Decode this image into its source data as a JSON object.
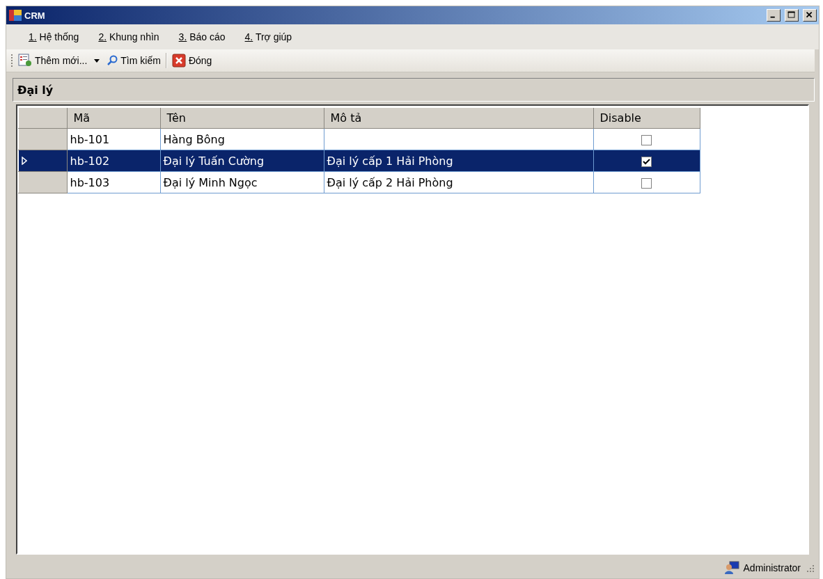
{
  "window": {
    "title": "CRM"
  },
  "menu": [
    {
      "label": "1. Hệ thống"
    },
    {
      "label": "2. Khung nhìn"
    },
    {
      "label": "3. Báo cáo"
    },
    {
      "label": "4. Trợ giúp"
    }
  ],
  "toolbar": [
    {
      "kind": "add",
      "label": "Thêm mới..."
    },
    {
      "kind": "dropdown"
    },
    {
      "kind": "search",
      "label": "Tìm kiếm"
    },
    {
      "kind": "separator"
    },
    {
      "kind": "close",
      "label": "Đóng"
    }
  ],
  "panel": {
    "title": "Đại lý"
  },
  "table": {
    "columns": [
      "Mã",
      "Tên",
      "Mô tả",
      "Disable"
    ],
    "rows": [
      {
        "code": "hb-101",
        "name": "Hàng Bông",
        "description": "",
        "disabled": false,
        "selected": false
      },
      {
        "code": "hb-102",
        "name": "Đại lý Tuấn Cường",
        "description": "Đại lý cấp 1 Hải Phòng",
        "disabled": true,
        "selected": true
      },
      {
        "code": "hb-103",
        "name": "Đại lý Minh Ngọc",
        "description": "Đại lý cấp 2 Hải Phòng",
        "disabled": false,
        "selected": false
      }
    ]
  },
  "status_bar": {
    "user": "Administrator"
  }
}
